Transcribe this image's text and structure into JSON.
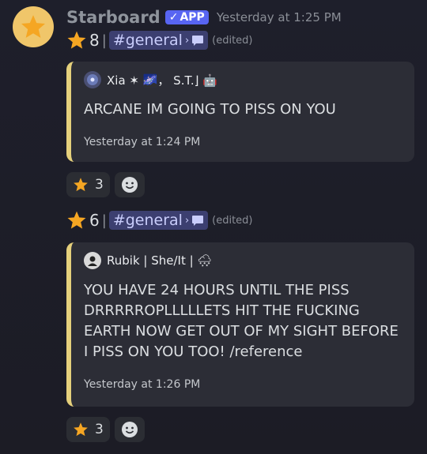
{
  "bot": {
    "name": "Starboard",
    "badge": "APP",
    "timestamp": "Yesterday at 1:25 PM"
  },
  "messages": [
    {
      "star_count": "8",
      "separator": "|",
      "channel": "#general",
      "chevron": "›",
      "edited": "(edited)",
      "embed": {
        "author": "Xia ✶ 🌌， S.T.⌋ 🤖",
        "body": "ARCANE IM GOING TO PISS ON YOU",
        "footer": "Yesterday at 1:24 PM"
      },
      "reaction_count": "3"
    },
    {
      "star_count": "6",
      "separator": "|",
      "channel": "#general",
      "chevron": "›",
      "edited": "(edited)",
      "embed": {
        "author": "Rubik | She/It | 🌨",
        "body": "YOU HAVE 24 HOURS UNTIL THE PISS DRRRRROPLLLLLETS HIT THE FUCKING EARTH NOW GET OUT OF MY SIGHT BEFORE I PISS ON YOU TOO! /reference",
        "footer": "Yesterday at 1:26 PM"
      },
      "reaction_count": "3"
    }
  ],
  "colors": {
    "accent_bar": "#e5d07c",
    "star": "#f5a623",
    "badge": "#5865f2"
  }
}
